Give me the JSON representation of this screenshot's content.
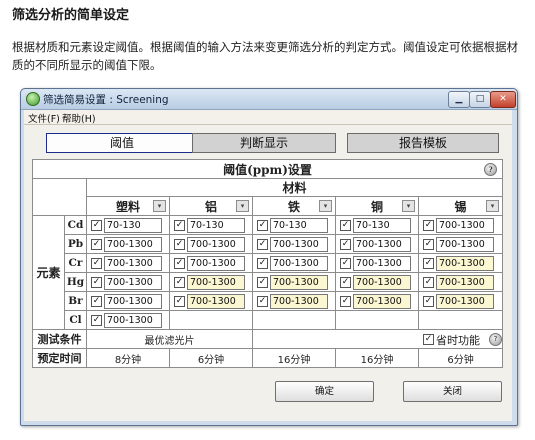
{
  "page": {
    "title": "筛选分析的简单设定",
    "description": "根据材质和元素设定阈值。根据阈值的输入方法来变更筛选分析的判定方式。阈值设定可依据根据材质的不同所显示的阈值下限。"
  },
  "window": {
    "title": "筛选简易设置 : Screening",
    "min_label": "▁",
    "max_label": "□",
    "close_label": "✕"
  },
  "menu": {
    "file": "文件(F)",
    "help": "帮助(H)"
  },
  "tabs": {
    "threshold": "阈值",
    "judge": "判断显示",
    "report": "报告模板"
  },
  "grid": {
    "header": "阈值(ppm)设置",
    "material_header": "材料",
    "element_group": "元素",
    "check_mark": "✓",
    "dropdown_glyph": "▾",
    "help_glyph": "?",
    "materials": [
      "塑料",
      "铝",
      "铁",
      "铜",
      "锡"
    ],
    "rows": [
      {
        "element": "Cd",
        "values": [
          "70-130",
          "70-130",
          "70-130",
          "70-130",
          "700-1300"
        ]
      },
      {
        "element": "Pb",
        "values": [
          "700-1300",
          "700-1300",
          "700-1300",
          "700-1300",
          "700-1300"
        ]
      },
      {
        "element": "Cr",
        "values": [
          "700-1300",
          "700-1300",
          "700-1300",
          "700-1300",
          "700-1300"
        ]
      },
      {
        "element": "Hg",
        "values": [
          "700-1300",
          "700-1300",
          "700-1300",
          "700-1300",
          "700-1300"
        ]
      },
      {
        "element": "Br",
        "values": [
          "700-1300",
          "700-1300",
          "700-1300",
          "700-1300",
          "700-1300"
        ]
      },
      {
        "element": "Cl",
        "values": [
          "700-1300"
        ]
      }
    ],
    "test_condition_label": "测试条件",
    "test_condition_value": "最优滤光片",
    "save_label": "省时功能",
    "time_label": "预定时间",
    "times": [
      "8分钟",
      "6分钟",
      "16分钟",
      "16分钟",
      "6分钟"
    ]
  },
  "buttons": {
    "ok": "确定",
    "close": "关闭"
  },
  "colors": {
    "window_frame": "#cfdceb",
    "highlight_input": "#fbf7d2",
    "active_tab_border": "#1c2c8c"
  },
  "icons": [
    "app-icon",
    "dropdown-icon",
    "help-icon",
    "checkbox-icon"
  ]
}
